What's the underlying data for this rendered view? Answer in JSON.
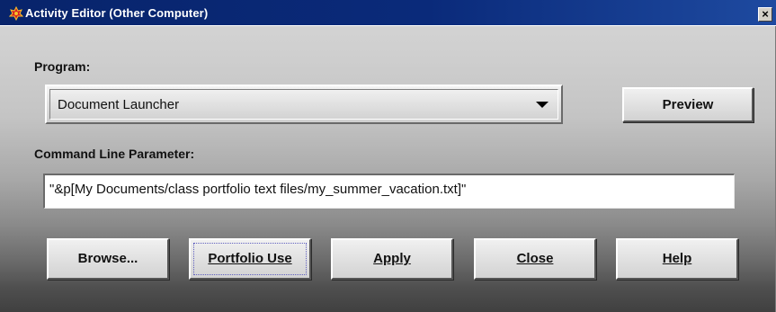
{
  "window": {
    "title": "Activity Editor (Other Computer)",
    "close_glyph": "×"
  },
  "program": {
    "label": "Program:",
    "selected": "Document Launcher"
  },
  "preview_button": "Preview",
  "command_line": {
    "label": "Command Line Parameter:",
    "value": "\"&p[My Documents/class portfolio text files/my_summer_vacation.txt]\""
  },
  "buttons": {
    "browse": "Browse...",
    "portfolio_use": "Portfolio Use",
    "apply": "Apply",
    "close": "Close",
    "help": "Help"
  },
  "icons": {
    "app": "app-logo-icon",
    "close": "close-icon",
    "dropdown": "chevron-down-icon"
  },
  "colors": {
    "titlebar": "#0a246a",
    "titlebar_text": "#ffffff"
  }
}
